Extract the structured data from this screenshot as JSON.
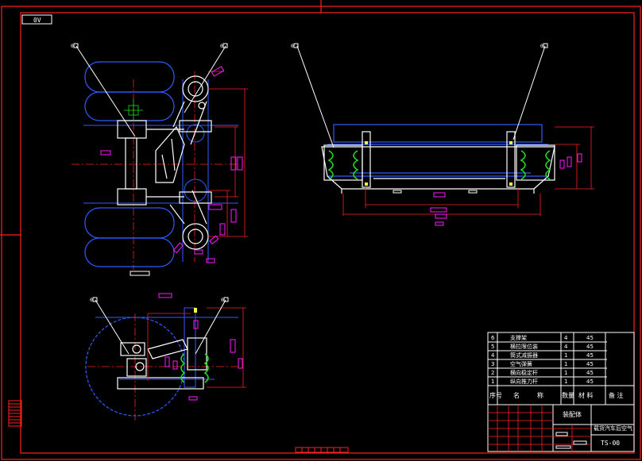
{
  "drawing": {
    "corner_tag": "0V",
    "balloon_label": "0",
    "code": "TS-00",
    "assembly_title": "装配体",
    "title_text": "载货汽车后空气"
  },
  "bom": {
    "rows": [
      {
        "no": "6",
        "name": "支撑架",
        "qty": "4",
        "material": "45"
      },
      {
        "no": "5",
        "name": "横拉限位装",
        "qty": "4",
        "material": "45"
      },
      {
        "no": "4",
        "name": "筒式减振器",
        "qty": "1",
        "material": "45"
      },
      {
        "no": "3",
        "name": "空气弹簧",
        "qty": "1",
        "material": "45"
      },
      {
        "no": "2",
        "name": "横向稳定杆",
        "qty": "1",
        "material": "45"
      },
      {
        "no": "1",
        "name": "纵向推力杆",
        "qty": "1",
        "material": "45"
      }
    ],
    "header": {
      "no": "序号",
      "name": "名",
      "name2": "称",
      "qty": "数量",
      "material": "材 料",
      "remark": "备 注"
    }
  },
  "colors": {
    "frame": "#ff2020",
    "blue": "#2f5bff",
    "white": "#ffffff",
    "magenta": "#ff1aff",
    "green": "#22dd22",
    "red": "#ff2020",
    "cyan": "#22e0ff",
    "yellow": "#ffff33"
  }
}
